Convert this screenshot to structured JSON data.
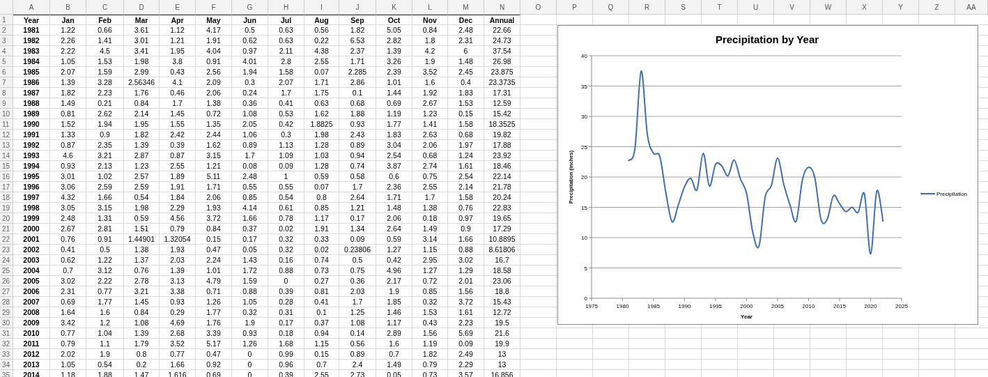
{
  "column_headers": [
    "A",
    "B",
    "C",
    "D",
    "E",
    "F",
    "G",
    "H",
    "I",
    "J",
    "K",
    "L",
    "M",
    "N",
    "O",
    "P",
    "Q",
    "R",
    "S",
    "T",
    "U",
    "V",
    "W",
    "X",
    "Y",
    "Z",
    "AA"
  ],
  "row_numbers": [
    "1",
    "2",
    "3",
    "4",
    "5",
    "6",
    "7",
    "8",
    "9",
    "10",
    "11",
    "12",
    "13",
    "14",
    "15",
    "16",
    "17",
    "18",
    "19",
    "20",
    "21",
    "22",
    "23",
    "24",
    "25",
    "26",
    "27",
    "28",
    "29",
    "30",
    "31",
    "32",
    "33",
    "34",
    "35"
  ],
  "table": {
    "columns": [
      "Year",
      "Jan",
      "Feb",
      "Mar",
      "Apr",
      "May",
      "Jun",
      "Jul",
      "Aug",
      "Sep",
      "Oct",
      "Nov",
      "Dec",
      "Annual"
    ],
    "rows": [
      [
        "1981",
        "1.22",
        "0.66",
        "3.61",
        "1.12",
        "4.17",
        "0.5",
        "0.63",
        "0.56",
        "1.82",
        "5.05",
        "0.84",
        "2.48",
        "22.66"
      ],
      [
        "1982",
        "2.26",
        "1.41",
        "3.01",
        "1.21",
        "1.91",
        "0.62",
        "0.63",
        "0.22",
        "6.53",
        "2.82",
        "1.8",
        "2.31",
        "24.73"
      ],
      [
        "1983",
        "2.22",
        "4.5",
        "3.41",
        "1.95",
        "4.04",
        "0.97",
        "2.11",
        "4.38",
        "2.37",
        "1.39",
        "4.2",
        "6",
        "37.54"
      ],
      [
        "1984",
        "1.05",
        "1.53",
        "1.98",
        "3.8",
        "0.91",
        "4.01",
        "2.8",
        "2.55",
        "1.71",
        "3.26",
        "1.9",
        "1.48",
        "26.98"
      ],
      [
        "1985",
        "2.07",
        "1.59",
        "2.99",
        "0.43",
        "2.56",
        "1.94",
        "1.58",
        "0.07",
        "2.285",
        "2.39",
        "3.52",
        "2.45",
        "23.875"
      ],
      [
        "1986",
        "1.39",
        "3.28",
        "2.56346",
        "4.1",
        "2.09",
        "0.3",
        "2.07",
        "1.71",
        "2.86",
        "1.01",
        "1.6",
        "0.4",
        "23.3735"
      ],
      [
        "1987",
        "1.82",
        "2.23",
        "1.76",
        "0.46",
        "2.06",
        "0.24",
        "1.7",
        "1.75",
        "0.1",
        "1.44",
        "1.92",
        "1.83",
        "17.31"
      ],
      [
        "1988",
        "1.49",
        "0.21",
        "0.84",
        "1.7",
        "1.38",
        "0.36",
        "0.41",
        "0.63",
        "0.68",
        "0.69",
        "2.67",
        "1.53",
        "12.59"
      ],
      [
        "1989",
        "0.81",
        "2.62",
        "2.14",
        "1.45",
        "0.72",
        "1.08",
        "0.53",
        "1.62",
        "1.88",
        "1.19",
        "1.23",
        "0.15",
        "15.42"
      ],
      [
        "1990",
        "1.52",
        "1.94",
        "1.95",
        "1.55",
        "1.35",
        "2.05",
        "0.42",
        "1.8825",
        "0.93",
        "1.77",
        "1.41",
        "1.58",
        "18.3525"
      ],
      [
        "1991",
        "1.33",
        "0.9",
        "1.82",
        "2.42",
        "2.44",
        "1.06",
        "0.3",
        "1.98",
        "2.43",
        "1.83",
        "2.63",
        "0.68",
        "19.82"
      ],
      [
        "1992",
        "0.87",
        "2.35",
        "1.39",
        "0.39",
        "1.62",
        "0.89",
        "1.13",
        "1.28",
        "0.89",
        "3.04",
        "2.06",
        "1.97",
        "17.88"
      ],
      [
        "1993",
        "4.6",
        "3.21",
        "2.87",
        "0.87",
        "3.15",
        "1.7",
        "1.09",
        "1.03",
        "0.94",
        "2.54",
        "0.68",
        "1.24",
        "23.92"
      ],
      [
        "1994",
        "0.93",
        "2.13",
        "1.23",
        "2.55",
        "1.21",
        "0.08",
        "0.09",
        "1.28",
        "0.74",
        "3.87",
        "2.74",
        "1.61",
        "18.46"
      ],
      [
        "1995",
        "3.01",
        "1.02",
        "2.57",
        "1.89",
        "5.11",
        "2.48",
        "1",
        "0.59",
        "0.58",
        "0.6",
        "0.75",
        "2.54",
        "22.14"
      ],
      [
        "1996",
        "3.06",
        "2.59",
        "2.59",
        "1.91",
        "1.71",
        "0.55",
        "0.55",
        "0.07",
        "1.7",
        "2.36",
        "2.55",
        "2.14",
        "21.78"
      ],
      [
        "1997",
        "4.32",
        "1.66",
        "0.54",
        "1.84",
        "2.06",
        "0.85",
        "0.54",
        "0.8",
        "2.64",
        "1.71",
        "1.7",
        "1.58",
        "20.24"
      ],
      [
        "1998",
        "3.05",
        "3.15",
        "1.98",
        "2.29",
        "1.93",
        "4.14",
        "0.61",
        "0.85",
        "1.21",
        "1.48",
        "1.38",
        "0.76",
        "22.83"
      ],
      [
        "1999",
        "2.48",
        "1.31",
        "0.59",
        "4.56",
        "3.72",
        "1.66",
        "0.78",
        "1.17",
        "0.17",
        "2.06",
        "0.18",
        "0.97",
        "19.65"
      ],
      [
        "2000",
        "2.67",
        "2.81",
        "1.51",
        "0.79",
        "0.84",
        "0.37",
        "0.02",
        "1.91",
        "1.34",
        "2.64",
        "1.49",
        "0.9",
        "17.29"
      ],
      [
        "2001",
        "0.76",
        "0.91",
        "1.44901",
        "1.32054",
        "0.15",
        "0.17",
        "0.32",
        "0.33",
        "0.09",
        "0.59",
        "3.14",
        "1.66",
        "10.8895"
      ],
      [
        "2002",
        "0.41",
        "0.5",
        "1.38",
        "1.93",
        "0.47",
        "0.05",
        "0.32",
        "0.02",
        "0.23806",
        "1.27",
        "1.15",
        "0.88",
        "8.61806"
      ],
      [
        "2003",
        "0.62",
        "1.22",
        "1.37",
        "2.03",
        "2.24",
        "1.43",
        "0.16",
        "0.74",
        "0.5",
        "0.42",
        "2.95",
        "3.02",
        "16.7"
      ],
      [
        "2004",
        "0.7",
        "3.12",
        "0.76",
        "1.39",
        "1.01",
        "1.72",
        "0.88",
        "0.73",
        "0.75",
        "4.96",
        "1.27",
        "1.29",
        "18.58"
      ],
      [
        "2005",
        "3.02",
        "2.22",
        "2.78",
        "3.13",
        "4.79",
        "1.59",
        "0",
        "0.27",
        "0.36",
        "2.17",
        "0.72",
        "2.01",
        "23.06"
      ],
      [
        "2006",
        "2.31",
        "0.77",
        "3.21",
        "3.38",
        "0.71",
        "0.88",
        "0.39",
        "0.81",
        "2.03",
        "1.9",
        "0.85",
        "1.56",
        "18.8"
      ],
      [
        "2007",
        "0.69",
        "1.77",
        "1.45",
        "0.93",
        "1.26",
        "1.05",
        "0.28",
        "0.41",
        "1.7",
        "1.85",
        "0.32",
        "3.72",
        "15.43"
      ],
      [
        "2008",
        "1.64",
        "1.6",
        "0.84",
        "0.29",
        "1.77",
        "0.32",
        "0.31",
        "0.1",
        "1.25",
        "1.46",
        "1.53",
        "1.61",
        "12.72"
      ],
      [
        "2009",
        "3.42",
        "1.2",
        "1.08",
        "4.69",
        "1.76",
        "1.9",
        "0.17",
        "0.37",
        "1.08",
        "1.17",
        "0.43",
        "2.23",
        "19.5"
      ],
      [
        "2010",
        "0.77",
        "1.04",
        "1.39",
        "2.68",
        "3.39",
        "0.93",
        "0.18",
        "0.94",
        "0.14",
        "2.89",
        "1.56",
        "5.69",
        "21.6"
      ],
      [
        "2011",
        "0.79",
        "1.1",
        "1.79",
        "3.52",
        "5.17",
        "1.26",
        "1.68",
        "1.15",
        "0.56",
        "1.6",
        "1.19",
        "0.09",
        "19.9"
      ],
      [
        "2012",
        "2.02",
        "1.9",
        "0.8",
        "0.77",
        "0.47",
        "0",
        "0.99",
        "0.15",
        "0.89",
        "0.7",
        "1.82",
        "2.49",
        "13"
      ],
      [
        "2013",
        "1.05",
        "0.54",
        "0.2",
        "1.66",
        "0.92",
        "0",
        "0.96",
        "0.7",
        "2.4",
        "1.49",
        "0.79",
        "2.29",
        "13"
      ],
      [
        "2014",
        "1.18",
        "1.88",
        "1.47",
        "1.616",
        "0.69",
        "0",
        "0.39",
        "2.55",
        "2.73",
        "0.05",
        "0.73",
        "3.57",
        "16.856"
      ]
    ]
  },
  "chart": {
    "chart_data": {
      "type": "line",
      "title": "Precipitation by Year",
      "xlabel": "Year",
      "ylabel": "Precipitation (inches)",
      "x": [
        1981,
        1982,
        1983,
        1984,
        1985,
        1986,
        1987,
        1988,
        1989,
        1990,
        1991,
        1992,
        1993,
        1994,
        1995,
        1996,
        1997,
        1998,
        1999,
        2000,
        2001,
        2002,
        2003,
        2004,
        2005,
        2006,
        2007,
        2008,
        2009,
        2010,
        2011,
        2012,
        2013,
        2014,
        2015,
        2016,
        2017,
        2018,
        2019,
        2020,
        2021,
        2022
      ],
      "series": [
        {
          "name": "Precipitation",
          "color": "#3f6fb0",
          "values": [
            22.7,
            24.7,
            37.5,
            27,
            23.9,
            23.4,
            17.3,
            12.6,
            15.4,
            18.4,
            19.8,
            17.9,
            23.9,
            18.5,
            22.1,
            21.8,
            20.2,
            22.8,
            19.7,
            17.3,
            10.9,
            8.6,
            16.7,
            18.6,
            23.1,
            18.8,
            15.4,
            12.7,
            19.5,
            21.6,
            19.9,
            13,
            13,
            16.9,
            15.6,
            14.3,
            15,
            14.2,
            17.2,
            7.3,
            17.7,
            12.7
          ]
        }
      ],
      "xlim": [
        1975,
        2025
      ],
      "ylim": [
        0,
        40
      ],
      "xticks": [
        1975,
        1980,
        1985,
        1990,
        1995,
        2000,
        2005,
        2010,
        2015,
        2020,
        2025
      ],
      "yticks": [
        0,
        5,
        10,
        15,
        20,
        25,
        30,
        35,
        40
      ],
      "grid": true
    }
  }
}
